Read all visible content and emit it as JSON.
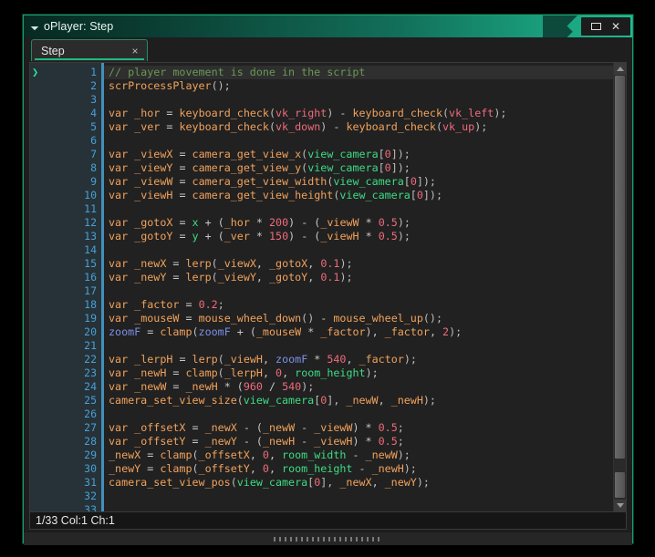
{
  "window": {
    "title": "oPlayer: Step",
    "collapse_icon": "triangle-collapse-icon",
    "maximize_label": "",
    "close_label": "✕"
  },
  "tabs": [
    {
      "label": "Step",
      "close": "×"
    }
  ],
  "statusbar": {
    "text": "1/33 Col:1 Ch:1"
  },
  "editor": {
    "cursor_marker": "❯",
    "line_numbers": [
      "1",
      "2",
      "3",
      "4",
      "5",
      "6",
      "7",
      "8",
      "9",
      "10",
      "11",
      "12",
      "13",
      "14",
      "15",
      "16",
      "17",
      "18",
      "19",
      "20",
      "21",
      "22",
      "23",
      "24",
      "25",
      "26",
      "27",
      "28",
      "29",
      "30",
      "31",
      "32",
      "33"
    ],
    "current_line": 1,
    "lines": [
      "// player movement is done in the script",
      "scrProcessPlayer();",
      "",
      "var _hor = keyboard_check(vk_right) - keyboard_check(vk_left);",
      "var _ver = keyboard_check(vk_down) - keyboard_check(vk_up);",
      "",
      "var _viewX = camera_get_view_x(view_camera[0]);",
      "var _viewY = camera_get_view_y(view_camera[0]);",
      "var _viewW = camera_get_view_width(view_camera[0]);",
      "var _viewH = camera_get_view_height(view_camera[0]);",
      "",
      "var _gotoX = x + (_hor * 200) - (_viewW * 0.5);",
      "var _gotoY = y + (_ver * 150) - (_viewH * 0.5);",
      "",
      "var _newX = lerp(_viewX, _gotoX, 0.1);",
      "var _newY = lerp(_viewY, _gotoY, 0.1);",
      "",
      "var _factor = 0.2;",
      "var _mouseW = mouse_wheel_down() - mouse_wheel_up();",
      "zoomF = clamp(zoomF + (_mouseW * _factor), _factor, 2);",
      "",
      "var _lerpH = lerp(_viewH, zoomF * 540, _factor);",
      "var _newH = clamp(_lerpH, 0, room_height);",
      "var _newW = _newH * (960 / 540);",
      "camera_set_view_size(view_camera[0], _newW, _newH);",
      "",
      "var _offsetX = _newX - (_newW - _viewW) * 0.5;",
      "var _offsetY = _newY - (_newH - _viewH) * 0.5;",
      "_newX = clamp(_offsetX, 0, room_width - _newW);",
      "_newY = clamp(_offsetY, 0, room_height - _newH);",
      "camera_set_view_pos(view_camera[0], _newX, _newY);",
      "",
      ""
    ],
    "tokens": [
      [
        [
          "// player movement is done in the script",
          "comment"
        ]
      ],
      [
        [
          "scrProcessPlayer",
          "fn"
        ],
        [
          "();",
          "punc"
        ]
      ],
      [],
      [
        [
          "var",
          "kw"
        ],
        [
          " ",
          "op"
        ],
        [
          "_hor",
          "var"
        ],
        [
          " = ",
          "op"
        ],
        [
          "keyboard_check",
          "fn"
        ],
        [
          "(",
          "punc"
        ],
        [
          "vk_right",
          "const"
        ],
        [
          ")",
          "punc"
        ],
        [
          " - ",
          "op"
        ],
        [
          "keyboard_check",
          "fn"
        ],
        [
          "(",
          "punc"
        ],
        [
          "vk_left",
          "const"
        ],
        [
          ");",
          "punc"
        ]
      ],
      [
        [
          "var",
          "kw"
        ],
        [
          " ",
          "op"
        ],
        [
          "_ver",
          "var"
        ],
        [
          " = ",
          "op"
        ],
        [
          "keyboard_check",
          "fn"
        ],
        [
          "(",
          "punc"
        ],
        [
          "vk_down",
          "const"
        ],
        [
          ")",
          "punc"
        ],
        [
          " - ",
          "op"
        ],
        [
          "keyboard_check",
          "fn"
        ],
        [
          "(",
          "punc"
        ],
        [
          "vk_up",
          "const"
        ],
        [
          ");",
          "punc"
        ]
      ],
      [],
      [
        [
          "var",
          "kw"
        ],
        [
          " ",
          "op"
        ],
        [
          "_viewX",
          "var"
        ],
        [
          " = ",
          "op"
        ],
        [
          "camera_get_view_x",
          "fn"
        ],
        [
          "(",
          "punc"
        ],
        [
          "view_camera",
          "builtin"
        ],
        [
          "[",
          "punc"
        ],
        [
          "0",
          "num"
        ],
        [
          "]);",
          "punc"
        ]
      ],
      [
        [
          "var",
          "kw"
        ],
        [
          " ",
          "op"
        ],
        [
          "_viewY",
          "var"
        ],
        [
          " = ",
          "op"
        ],
        [
          "camera_get_view_y",
          "fn"
        ],
        [
          "(",
          "punc"
        ],
        [
          "view_camera",
          "builtin"
        ],
        [
          "[",
          "punc"
        ],
        [
          "0",
          "num"
        ],
        [
          "]);",
          "punc"
        ]
      ],
      [
        [
          "var",
          "kw"
        ],
        [
          " ",
          "op"
        ],
        [
          "_viewW",
          "var"
        ],
        [
          " = ",
          "op"
        ],
        [
          "camera_get_view_width",
          "fn"
        ],
        [
          "(",
          "punc"
        ],
        [
          "view_camera",
          "builtin"
        ],
        [
          "[",
          "punc"
        ],
        [
          "0",
          "num"
        ],
        [
          "]);",
          "punc"
        ]
      ],
      [
        [
          "var",
          "kw"
        ],
        [
          " ",
          "op"
        ],
        [
          "_viewH",
          "var"
        ],
        [
          " = ",
          "op"
        ],
        [
          "camera_get_view_height",
          "fn"
        ],
        [
          "(",
          "punc"
        ],
        [
          "view_camera",
          "builtin"
        ],
        [
          "[",
          "punc"
        ],
        [
          "0",
          "num"
        ],
        [
          "]);",
          "punc"
        ]
      ],
      [],
      [
        [
          "var",
          "kw"
        ],
        [
          " ",
          "op"
        ],
        [
          "_gotoX",
          "var"
        ],
        [
          " = ",
          "op"
        ],
        [
          "x",
          "builtin"
        ],
        [
          " + (",
          "op"
        ],
        [
          "_hor",
          "var"
        ],
        [
          " * ",
          "op"
        ],
        [
          "200",
          "num"
        ],
        [
          ") - (",
          "op"
        ],
        [
          "_viewW",
          "var"
        ],
        [
          " * ",
          "op"
        ],
        [
          "0.5",
          "num"
        ],
        [
          ");",
          "punc"
        ]
      ],
      [
        [
          "var",
          "kw"
        ],
        [
          " ",
          "op"
        ],
        [
          "_gotoY",
          "var"
        ],
        [
          " = ",
          "op"
        ],
        [
          "y",
          "builtin"
        ],
        [
          " + (",
          "op"
        ],
        [
          "_ver",
          "var"
        ],
        [
          " * ",
          "op"
        ],
        [
          "150",
          "num"
        ],
        [
          ") - (",
          "op"
        ],
        [
          "_viewH",
          "var"
        ],
        [
          " * ",
          "op"
        ],
        [
          "0.5",
          "num"
        ],
        [
          ");",
          "punc"
        ]
      ],
      [],
      [
        [
          "var",
          "kw"
        ],
        [
          " ",
          "op"
        ],
        [
          "_newX",
          "var"
        ],
        [
          " = ",
          "op"
        ],
        [
          "lerp",
          "fn"
        ],
        [
          "(",
          "punc"
        ],
        [
          "_viewX",
          "var"
        ],
        [
          ", ",
          "op"
        ],
        [
          "_gotoX",
          "var"
        ],
        [
          ", ",
          "op"
        ],
        [
          "0.1",
          "num"
        ],
        [
          ");",
          "punc"
        ]
      ],
      [
        [
          "var",
          "kw"
        ],
        [
          " ",
          "op"
        ],
        [
          "_newY",
          "var"
        ],
        [
          " = ",
          "op"
        ],
        [
          "lerp",
          "fn"
        ],
        [
          "(",
          "punc"
        ],
        [
          "_viewY",
          "var"
        ],
        [
          ", ",
          "op"
        ],
        [
          "_gotoY",
          "var"
        ],
        [
          ", ",
          "op"
        ],
        [
          "0.1",
          "num"
        ],
        [
          ");",
          "punc"
        ]
      ],
      [],
      [
        [
          "var",
          "kw"
        ],
        [
          " ",
          "op"
        ],
        [
          "_factor",
          "var"
        ],
        [
          " = ",
          "op"
        ],
        [
          "0.2",
          "num"
        ],
        [
          ";",
          "punc"
        ]
      ],
      [
        [
          "var",
          "kw"
        ],
        [
          " ",
          "op"
        ],
        [
          "_mouseW",
          "var"
        ],
        [
          " = ",
          "op"
        ],
        [
          "mouse_wheel_down",
          "fn"
        ],
        [
          "()",
          "punc"
        ],
        [
          " - ",
          "op"
        ],
        [
          "mouse_wheel_up",
          "fn"
        ],
        [
          "();",
          "punc"
        ]
      ],
      [
        [
          "zoomF",
          "inst"
        ],
        [
          " = ",
          "op"
        ],
        [
          "clamp",
          "fn"
        ],
        [
          "(",
          "punc"
        ],
        [
          "zoomF",
          "inst"
        ],
        [
          " + (",
          "op"
        ],
        [
          "_mouseW",
          "var"
        ],
        [
          " * ",
          "op"
        ],
        [
          "_factor",
          "var"
        ],
        [
          "), ",
          "op"
        ],
        [
          "_factor",
          "var"
        ],
        [
          ", ",
          "op"
        ],
        [
          "2",
          "num"
        ],
        [
          ");",
          "punc"
        ]
      ],
      [],
      [
        [
          "var",
          "kw"
        ],
        [
          " ",
          "op"
        ],
        [
          "_lerpH",
          "var"
        ],
        [
          " = ",
          "op"
        ],
        [
          "lerp",
          "fn"
        ],
        [
          "(",
          "punc"
        ],
        [
          "_viewH",
          "var"
        ],
        [
          ", ",
          "op"
        ],
        [
          "zoomF",
          "inst"
        ],
        [
          " * ",
          "op"
        ],
        [
          "540",
          "num"
        ],
        [
          ", ",
          "op"
        ],
        [
          "_factor",
          "var"
        ],
        [
          ");",
          "punc"
        ]
      ],
      [
        [
          "var",
          "kw"
        ],
        [
          " ",
          "op"
        ],
        [
          "_newH",
          "var"
        ],
        [
          " = ",
          "op"
        ],
        [
          "clamp",
          "fn"
        ],
        [
          "(",
          "punc"
        ],
        [
          "_lerpH",
          "var"
        ],
        [
          ", ",
          "op"
        ],
        [
          "0",
          "num"
        ],
        [
          ", ",
          "op"
        ],
        [
          "room_height",
          "builtin"
        ],
        [
          ");",
          "punc"
        ]
      ],
      [
        [
          "var",
          "kw"
        ],
        [
          " ",
          "op"
        ],
        [
          "_newW",
          "var"
        ],
        [
          " = ",
          "op"
        ],
        [
          "_newH",
          "var"
        ],
        [
          " * (",
          "op"
        ],
        [
          "960",
          "num"
        ],
        [
          " / ",
          "op"
        ],
        [
          "540",
          "num"
        ],
        [
          ");",
          "punc"
        ]
      ],
      [
        [
          "camera_set_view_size",
          "fn"
        ],
        [
          "(",
          "punc"
        ],
        [
          "view_camera",
          "builtin"
        ],
        [
          "[",
          "punc"
        ],
        [
          "0",
          "num"
        ],
        [
          "], ",
          "punc"
        ],
        [
          "_newW",
          "var"
        ],
        [
          ", ",
          "op"
        ],
        [
          "_newH",
          "var"
        ],
        [
          ");",
          "punc"
        ]
      ],
      [],
      [
        [
          "var",
          "kw"
        ],
        [
          " ",
          "op"
        ],
        [
          "_offsetX",
          "var"
        ],
        [
          " = ",
          "op"
        ],
        [
          "_newX",
          "var"
        ],
        [
          " - (",
          "op"
        ],
        [
          "_newW",
          "var"
        ],
        [
          " - ",
          "op"
        ],
        [
          "_viewW",
          "var"
        ],
        [
          ") * ",
          "op"
        ],
        [
          "0.5",
          "num"
        ],
        [
          ";",
          "punc"
        ]
      ],
      [
        [
          "var",
          "kw"
        ],
        [
          " ",
          "op"
        ],
        [
          "_offsetY",
          "var"
        ],
        [
          " = ",
          "op"
        ],
        [
          "_newY",
          "var"
        ],
        [
          " - (",
          "op"
        ],
        [
          "_newH",
          "var"
        ],
        [
          " - ",
          "op"
        ],
        [
          "_viewH",
          "var"
        ],
        [
          ") * ",
          "op"
        ],
        [
          "0.5",
          "num"
        ],
        [
          ";",
          "punc"
        ]
      ],
      [
        [
          "_newX",
          "var"
        ],
        [
          " = ",
          "op"
        ],
        [
          "clamp",
          "fn"
        ],
        [
          "(",
          "punc"
        ],
        [
          "_offsetX",
          "var"
        ],
        [
          ", ",
          "op"
        ],
        [
          "0",
          "num"
        ],
        [
          ", ",
          "op"
        ],
        [
          "room_width",
          "builtin"
        ],
        [
          " - ",
          "op"
        ],
        [
          "_newW",
          "var"
        ],
        [
          ");",
          "punc"
        ]
      ],
      [
        [
          "_newY",
          "var"
        ],
        [
          " = ",
          "op"
        ],
        [
          "clamp",
          "fn"
        ],
        [
          "(",
          "punc"
        ],
        [
          "_offsetY",
          "var"
        ],
        [
          ", ",
          "op"
        ],
        [
          "0",
          "num"
        ],
        [
          ", ",
          "op"
        ],
        [
          "room_height",
          "builtin"
        ],
        [
          " - ",
          "op"
        ],
        [
          "_newH",
          "var"
        ],
        [
          ");",
          "punc"
        ]
      ],
      [
        [
          "camera_set_view_pos",
          "fn"
        ],
        [
          "(",
          "punc"
        ],
        [
          "view_camera",
          "builtin"
        ],
        [
          "[",
          "punc"
        ],
        [
          "0",
          "num"
        ],
        [
          "], ",
          "punc"
        ],
        [
          "_newX",
          "var"
        ],
        [
          ", ",
          "op"
        ],
        [
          "_newY",
          "var"
        ],
        [
          ");",
          "punc"
        ]
      ],
      [],
      []
    ]
  },
  "colors": {
    "title_accent": "#1fbb92",
    "tab_underline": "#1db87f",
    "editor_bg": "#212121",
    "gutter_bg": "#263238",
    "linenum": "#4a9fd4",
    "comment": "#6a9955",
    "keyword": "#f2a25c",
    "constant": "#ef6b7b",
    "builtin": "#3ddc84",
    "instance_var": "#7d8fe8"
  }
}
